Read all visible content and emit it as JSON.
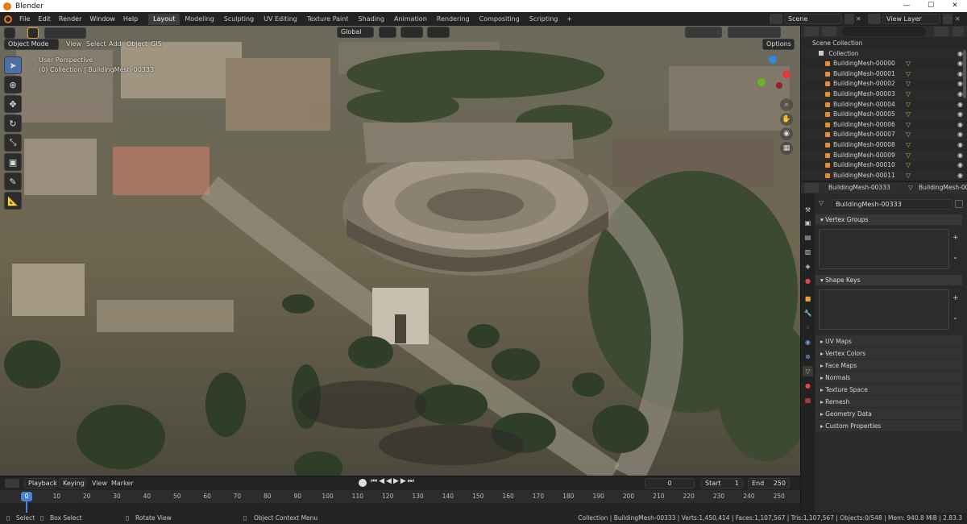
{
  "window": {
    "title": "Blender",
    "controls": [
      "—",
      "☐",
      "✕"
    ]
  },
  "menu": [
    "File",
    "Edit",
    "Render",
    "Window",
    "Help"
  ],
  "workspaces": [
    "Layout",
    "Modeling",
    "Sculpting",
    "UV Editing",
    "Texture Paint",
    "Shading",
    "Animation",
    "Rendering",
    "Compositing",
    "Scripting"
  ],
  "active_workspace": "Layout",
  "scene_field": "Scene",
  "view_layer_field": "View Layer",
  "viewport": {
    "mode": "Object Mode",
    "header_menus": [
      "View",
      "Select",
      "Add",
      "Object",
      "GIS"
    ],
    "orientation": "Global",
    "options_label": "Options",
    "overlay_line1": "User Perspective",
    "overlay_line2": "(0) Collection | BuildingMesh-00333"
  },
  "outliner": {
    "scene_collection": "Scene Collection",
    "collection": "Collection",
    "items": [
      "BuildingMesh-00000",
      "BuildingMesh-00001",
      "BuildingMesh-00002",
      "BuildingMesh-00003",
      "BuildingMesh-00004",
      "BuildingMesh-00005",
      "BuildingMesh-00006",
      "BuildingMesh-00007",
      "BuildingMesh-00008",
      "BuildingMesh-00009",
      "BuildingMesh-00010",
      "BuildingMesh-00011"
    ]
  },
  "properties": {
    "object_name": "BuildingMesh-00333",
    "data_name": "BuildingMesh-00333",
    "mesh_name": "BuildingMesh-00333",
    "vertex_groups": "Vertex Groups",
    "shape_keys": "Shape Keys",
    "sections": [
      "UV Maps",
      "Vertex Colors",
      "Face Maps",
      "Normals",
      "Texture Space",
      "Remesh",
      "Geometry Data",
      "Custom Properties"
    ]
  },
  "timeline": {
    "menus": [
      "Playback",
      "Keying",
      "View",
      "Marker"
    ],
    "current_frame": "0",
    "start_label": "Start",
    "start": "1",
    "end_label": "End",
    "end": "250",
    "ticks": [
      "0",
      "10",
      "20",
      "30",
      "40",
      "50",
      "60",
      "70",
      "80",
      "90",
      "100",
      "110",
      "120",
      "130",
      "140",
      "150",
      "160",
      "170",
      "180",
      "190",
      "200",
      "210",
      "220",
      "230",
      "240",
      "250"
    ]
  },
  "statusbar": {
    "select": "Select",
    "box_select": "Box Select",
    "rotate_view": "Rotate View",
    "context_menu": "Object Context Menu",
    "stats": "Collection | BuildingMesh-00333 | Verts:1,450,414 | Faces:1,107,567 | Tris:1,107,567 | Objects:0/548 | Mem: 940.8 MiB | 2.83.3"
  }
}
